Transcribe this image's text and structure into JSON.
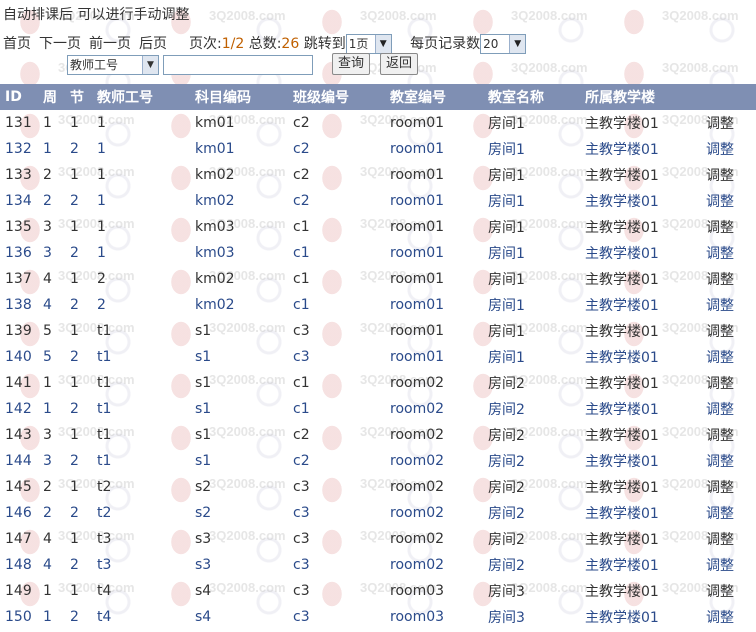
{
  "notice": "自动排课后 可以进行手动调整",
  "pager": {
    "first": "首页",
    "next": "下一页",
    "prev": "前一页",
    "last": "后页",
    "page_label": "页次:",
    "page_value": "1/2",
    "total_label": "总数:",
    "total_value": "26",
    "jump_label": "跳转到",
    "jump_value": "1页",
    "per_page_label": "每页记录数",
    "per_page_value": "20"
  },
  "search": {
    "field_value": "教师工号",
    "query_label": "查询",
    "back_label": "返回"
  },
  "table": {
    "headers": [
      "ID",
      "周",
      "节",
      "教师工号",
      "科目编码",
      "班级编号",
      "教室编号",
      "教室名称",
      "所属教学楼",
      ""
    ],
    "rows": [
      [
        "131",
        "1",
        "1",
        "1",
        "km01",
        "c2",
        "room01",
        "房间1",
        "主教学楼01",
        "调整"
      ],
      [
        "132",
        "1",
        "2",
        "1",
        "km01",
        "c2",
        "room01",
        "房间1",
        "主教学楼01",
        "调整"
      ],
      [
        "133",
        "2",
        "1",
        "1",
        "km02",
        "c2",
        "room01",
        "房间1",
        "主教学楼01",
        "调整"
      ],
      [
        "134",
        "2",
        "2",
        "1",
        "km02",
        "c2",
        "room01",
        "房间1",
        "主教学楼01",
        "调整"
      ],
      [
        "135",
        "3",
        "1",
        "1",
        "km03",
        "c1",
        "room01",
        "房间1",
        "主教学楼01",
        "调整"
      ],
      [
        "136",
        "3",
        "2",
        "1",
        "km03",
        "c1",
        "room01",
        "房间1",
        "主教学楼01",
        "调整"
      ],
      [
        "137",
        "4",
        "1",
        "2",
        "km02",
        "c1",
        "room01",
        "房间1",
        "主教学楼01",
        "调整"
      ],
      [
        "138",
        "4",
        "2",
        "2",
        "km02",
        "c1",
        "room01",
        "房间1",
        "主教学楼01",
        "调整"
      ],
      [
        "139",
        "5",
        "1",
        "t1",
        "s1",
        "c3",
        "room01",
        "房间1",
        "主教学楼01",
        "调整"
      ],
      [
        "140",
        "5",
        "2",
        "t1",
        "s1",
        "c3",
        "room01",
        "房间1",
        "主教学楼01",
        "调整"
      ],
      [
        "141",
        "1",
        "1",
        "t1",
        "s1",
        "c1",
        "room02",
        "房间2",
        "主教学楼01",
        "调整"
      ],
      [
        "142",
        "1",
        "2",
        "t1",
        "s1",
        "c1",
        "room02",
        "房间2",
        "主教学楼01",
        "调整"
      ],
      [
        "143",
        "3",
        "1",
        "t1",
        "s1",
        "c2",
        "room02",
        "房间2",
        "主教学楼01",
        "调整"
      ],
      [
        "144",
        "3",
        "2",
        "t1",
        "s1",
        "c2",
        "room02",
        "房间2",
        "主教学楼01",
        "调整"
      ],
      [
        "145",
        "2",
        "1",
        "t2",
        "s2",
        "c3",
        "room02",
        "房间2",
        "主教学楼01",
        "调整"
      ],
      [
        "146",
        "2",
        "2",
        "t2",
        "s2",
        "c3",
        "room02",
        "房间2",
        "主教学楼01",
        "调整"
      ],
      [
        "147",
        "4",
        "1",
        "t3",
        "s3",
        "c3",
        "room02",
        "房间2",
        "主教学楼01",
        "调整"
      ],
      [
        "148",
        "4",
        "2",
        "t3",
        "s3",
        "c3",
        "room02",
        "房间2",
        "主教学楼01",
        "调整"
      ],
      [
        "149",
        "1",
        "1",
        "t4",
        "s4",
        "c3",
        "room03",
        "房间3",
        "主教学楼01",
        "调整"
      ],
      [
        "150",
        "1",
        "2",
        "t4",
        "s4",
        "c3",
        "room03",
        "房间3",
        "主教学楼01",
        "调整"
      ]
    ]
  },
  "watermark": "3Q2008.com",
  "colors": {
    "header_bg": "#7f8fb3",
    "page_num": "#c06000",
    "even_row_text": "#2a4a8a"
  }
}
